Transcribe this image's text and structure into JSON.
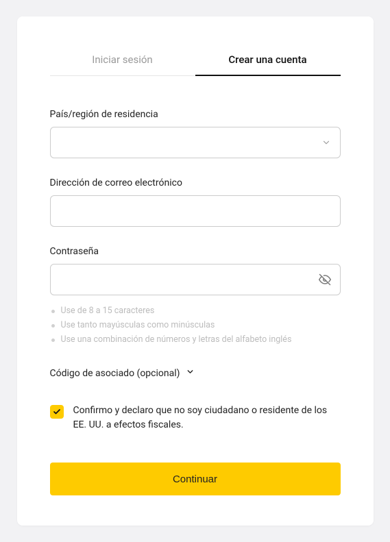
{
  "tabs": {
    "login": "Iniciar sesión",
    "signup": "Crear una cuenta"
  },
  "fields": {
    "country": {
      "label": "País/región de residencia",
      "value": ""
    },
    "email": {
      "label": "Dirección de correo electrónico",
      "value": ""
    },
    "password": {
      "label": "Contraseña",
      "value": ""
    }
  },
  "password_hints": [
    "Use de 8 a 15 caracteres",
    "Use tanto mayúsculas como minúsculas",
    "Use una combinación de números y letras del alfabeto inglés"
  ],
  "associate": {
    "label": "Código de asociado (opcional)"
  },
  "declaration": {
    "text": "Confirmo y declaro que no soy ciudadano o residente de los EE. UU. a efectos fiscales."
  },
  "buttons": {
    "continue": "Continuar"
  },
  "colors": {
    "accent": "#fecb00"
  }
}
